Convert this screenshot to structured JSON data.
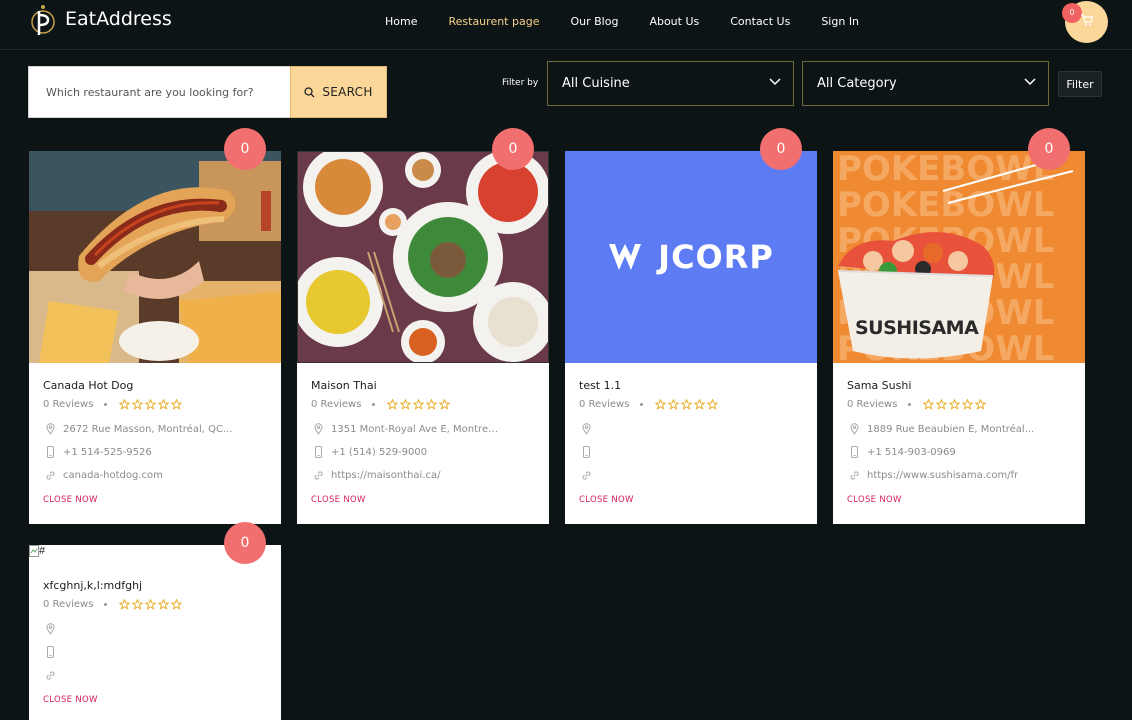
{
  "brand": {
    "name": "EatAddress"
  },
  "nav": {
    "items": [
      {
        "label": "Home"
      },
      {
        "label": "Restaurent page"
      },
      {
        "label": "Our Blog"
      },
      {
        "label": "About Us"
      },
      {
        "label": "Contact Us"
      },
      {
        "label": "Sign In"
      }
    ]
  },
  "cart": {
    "count": "0"
  },
  "search": {
    "placeholder": "Which restaurant are you looking for?",
    "button_label": "SEARCH"
  },
  "filters": {
    "label": "Filter by",
    "cuisine": "All Cuisine",
    "category": "All Category",
    "button_label": "Filter"
  },
  "colors": {
    "accent": "#fbd79a",
    "active_nav": "#f5d08a",
    "badge": "#f26f6f",
    "status": "#d4215f",
    "star": "#e6a817"
  },
  "cards": [
    {
      "title": "Canada Hot Dog",
      "reviews": "0 Reviews",
      "count": "0",
      "address": "2672 Rue Masson, Montréal, QC...",
      "phone": "+1 514-525-9526",
      "website": "canada-hotdog.com",
      "status": "CLOSE NOW"
    },
    {
      "title": "Maison Thai",
      "reviews": "0 Reviews",
      "count": "0",
      "address": "1351 Mont-Royal Ave E, Montrea...",
      "phone": "+1 (514) 529-9000",
      "website": "https://maisonthai.ca/",
      "status": "CLOSE NOW"
    },
    {
      "title": "test 1.1",
      "reviews": "0 Reviews",
      "count": "0",
      "address": "",
      "phone": "",
      "website": "",
      "status": "CLOSE NOW",
      "logo_text": "JCORP"
    },
    {
      "title": "Sama Sushi",
      "reviews": "0 Reviews",
      "count": "0",
      "address": "1889 Rue Beaubien E, Montréal...",
      "phone": "+1 514-903-0969",
      "website": "https://www.sushisama.com/fr",
      "status": "CLOSE NOW",
      "banner_text": "POKEBOWL",
      "brand_text": "SUSHISAMA"
    },
    {
      "title": "xfcghnj,k,l:mdfghj",
      "reviews": "0 Reviews",
      "count": "0",
      "address": "",
      "phone": "",
      "website": "",
      "status": "CLOSE NOW",
      "image_alt": "#"
    }
  ]
}
